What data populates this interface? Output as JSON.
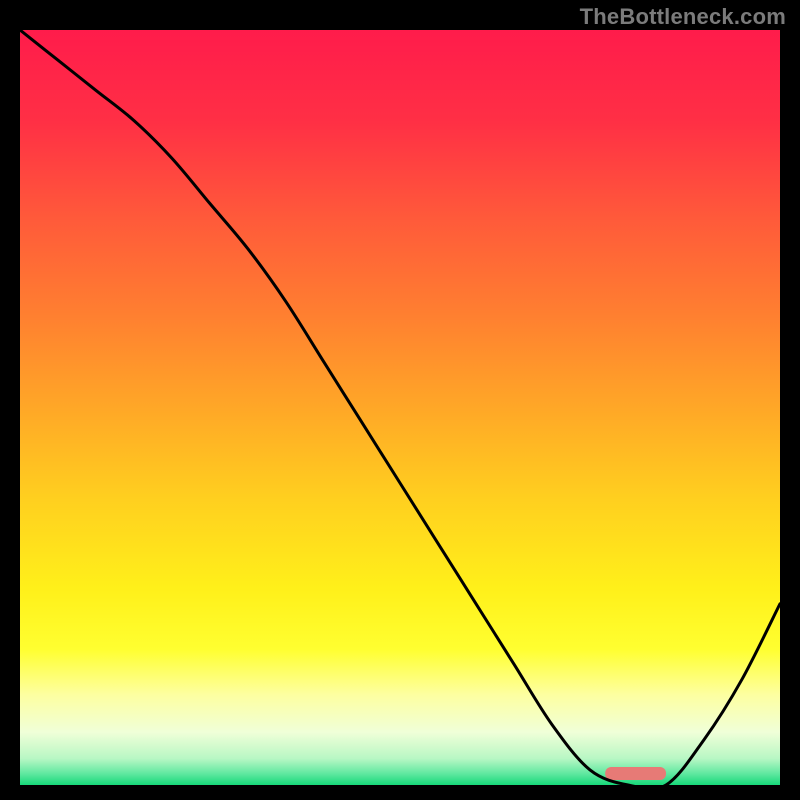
{
  "watermark": "TheBottleneck.com",
  "chart_data": {
    "type": "line",
    "title": "",
    "xlabel": "",
    "ylabel": "",
    "xlim": [
      0,
      100
    ],
    "ylim": [
      0,
      100
    ],
    "series": [
      {
        "name": "curve",
        "x": [
          0,
          5,
          10,
          15,
          20,
          25,
          30,
          35,
          40,
          45,
          50,
          55,
          60,
          65,
          70,
          75,
          80,
          85,
          90,
          95,
          100
        ],
        "y": [
          100,
          96,
          92,
          88,
          83,
          77,
          71,
          64,
          56,
          48,
          40,
          32,
          24,
          16,
          8,
          2,
          0,
          0,
          6,
          14,
          24
        ]
      }
    ],
    "marker": {
      "x": 81,
      "width": 8,
      "color": "#e77a76"
    },
    "background_gradient": {
      "stops": [
        {
          "offset": 0.0,
          "color": "#ff1c4b"
        },
        {
          "offset": 0.12,
          "color": "#ff2f45"
        },
        {
          "offset": 0.25,
          "color": "#ff5a3a"
        },
        {
          "offset": 0.38,
          "color": "#ff8030"
        },
        {
          "offset": 0.5,
          "color": "#ffa727"
        },
        {
          "offset": 0.62,
          "color": "#ffcf1f"
        },
        {
          "offset": 0.74,
          "color": "#fff01a"
        },
        {
          "offset": 0.82,
          "color": "#ffff30"
        },
        {
          "offset": 0.88,
          "color": "#fdffa0"
        },
        {
          "offset": 0.93,
          "color": "#f0ffd8"
        },
        {
          "offset": 0.965,
          "color": "#b8f7c4"
        },
        {
          "offset": 0.985,
          "color": "#5fe8a0"
        },
        {
          "offset": 1.0,
          "color": "#17d879"
        }
      ]
    }
  }
}
